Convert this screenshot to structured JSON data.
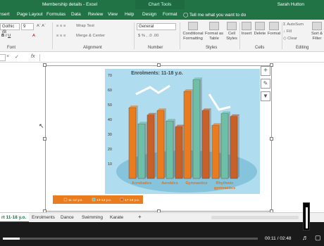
{
  "titlebar": {
    "title": "Membership details  -  Excel",
    "context": "Chart Tools",
    "user": "Sarah Hutton"
  },
  "tabs": [
    "nsert",
    "Page Layout",
    "Formulas",
    "Data",
    "Review",
    "View",
    "Help",
    "Design",
    "Format"
  ],
  "tellme": "Tell me what you want to do",
  "ribbon": {
    "font_name": "Gothic (B",
    "font_size": "9",
    "wrap_text": "Wrap Text",
    "merge": "Merge & Center",
    "number_format": "General",
    "cond_format": "Conditional Formatting",
    "format_table": "Format as Table",
    "cell_styles": "Cell Styles",
    "insert": "Insert",
    "delete": "Delete",
    "format": "Format",
    "autosum": "AutoSum",
    "fill": "Fill",
    "clear": "Clear",
    "sort": "Sort & Filter",
    "groups": {
      "font": "Font",
      "alignment": "Alignment",
      "number": "Number",
      "styles": "Styles",
      "cells": "Cells",
      "editing": "Editing"
    }
  },
  "formula_bar": {
    "cancel": "×",
    "confirm": "✓",
    "fx": "fx"
  },
  "chart_data": {
    "type": "bar",
    "title": "Enrolments: 11-18 y.o.",
    "categories": [
      "Acrobatics",
      "Aerobics",
      "Gymnastics",
      "Rhythmic gymnastics"
    ],
    "ylim": [
      0,
      70
    ],
    "yticks": [
      "70",
      "60",
      "50",
      "40",
      "30",
      "20",
      "10"
    ],
    "series": [
      {
        "name": "11-12 y.o.",
        "color": "#e97c1e",
        "values": [
          48,
          46,
          59,
          36
        ]
      },
      {
        "name": "13-14 y.o.",
        "color": "#6dbfa8",
        "values": [
          37,
          39,
          67,
          44
        ]
      },
      {
        "name": "17-18 y.o.",
        "color": "#c8602a",
        "values": [
          43,
          35,
          46,
          42
        ]
      }
    ]
  },
  "sheet_tabs": {
    "items": [
      "rt 11-18 y.o.",
      "Enrolments",
      "Dance",
      "Swimming",
      "Karate"
    ],
    "add": "+"
  },
  "video": {
    "time": "00:11 / 02:48",
    "progress": 0.065
  }
}
